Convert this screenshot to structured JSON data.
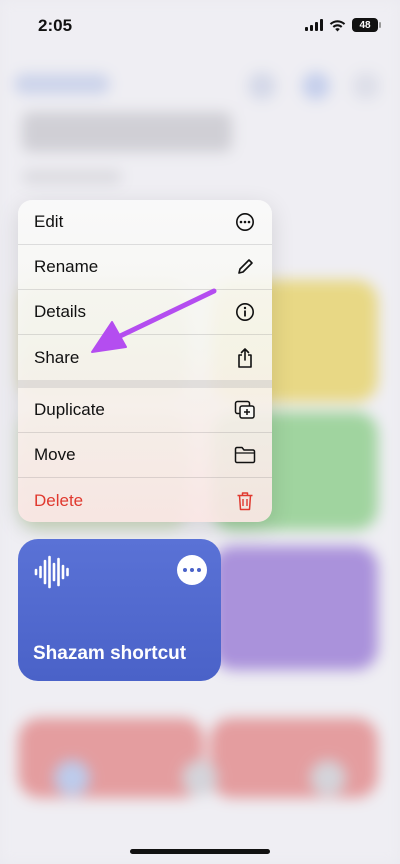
{
  "status_bar": {
    "time": "2:05",
    "battery": "48"
  },
  "context_menu": {
    "items": [
      {
        "label": "Edit",
        "icon": "ellipsis-circle-icon"
      },
      {
        "label": "Rename",
        "icon": "pencil-icon"
      },
      {
        "label": "Details",
        "icon": "info-circle-icon"
      },
      {
        "label": "Share",
        "icon": "share-icon"
      },
      {
        "label": "Duplicate",
        "icon": "duplicate-icon"
      },
      {
        "label": "Move",
        "icon": "folder-icon"
      },
      {
        "label": "Delete",
        "icon": "trash-icon"
      }
    ],
    "danger_color": "#e0392f"
  },
  "shortcut_card": {
    "title": "Shazam shortcut",
    "icon": "waveform-icon",
    "more_icon": "ellipsis-icon",
    "color": "#4a62c8"
  },
  "annotation": {
    "arrow_color": "#b44df0",
    "points_to": "Share"
  }
}
